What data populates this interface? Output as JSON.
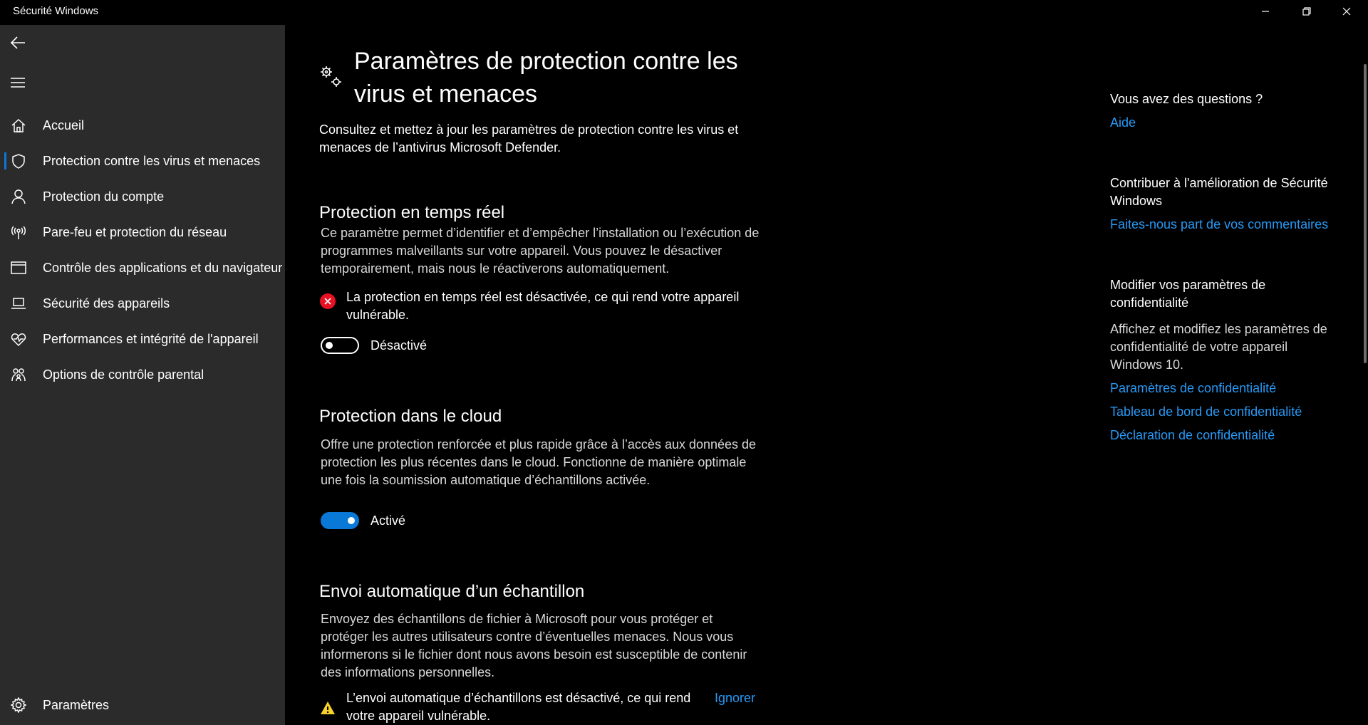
{
  "window": {
    "title": "Sécurité Windows"
  },
  "sidebar": {
    "items": [
      {
        "label": "Accueil",
        "icon": "home-icon"
      },
      {
        "label": "Protection contre les virus et menaces",
        "icon": "shield-icon",
        "selected": true
      },
      {
        "label": "Protection du compte",
        "icon": "person-icon"
      },
      {
        "label": "Pare-feu et protection du réseau",
        "icon": "wireless-icon"
      },
      {
        "label": "Contrôle des applications et du navigateur",
        "icon": "browser-window-icon"
      },
      {
        "label": "Sécurité des appareils",
        "icon": "laptop-icon"
      },
      {
        "label": "Performances et intégrité de l'appareil",
        "icon": "heart-pulse-icon"
      },
      {
        "label": "Options de contrôle parental",
        "icon": "family-icon"
      }
    ],
    "settings_label": "Paramètres"
  },
  "main": {
    "title": "Paramètres de protection contre les virus et menaces",
    "description": "Consultez et mettez à jour les paramètres de protection contre les virus et menaces de l’antivirus Microsoft Defender.",
    "realtime": {
      "heading": "Protection en temps réel",
      "description": "Ce paramètre permet d’identifier et d’empêcher l’installation ou l’exécution de programmes malveillants sur votre appareil. Vous pouvez le désactiver temporairement, mais nous le réactiverons automatiquement.",
      "status": "La protection en temps réel est désactivée, ce qui rend votre appareil vulnérable.",
      "toggle_label": "Désactivé",
      "toggle_on": false
    },
    "cloud": {
      "heading": "Protection dans le cloud",
      "description": "Offre une protection renforcée et plus rapide grâce à l’accès aux données de protection les plus récentes dans le cloud. Fonctionne de manière optimale une fois la soumission automatique d’échantillons activée.",
      "toggle_label": "Activé",
      "toggle_on": true
    },
    "sample": {
      "heading": "Envoi automatique d’un échantillon",
      "description": "Envoyez des échantillons de fichier à Microsoft pour vous protéger et protéger les autres utilisateurs contre d’éventuelles menaces. Nous vous informerons si le fichier dont nous avons besoin est susceptible de contenir des informations personnelles.",
      "status": "L’envoi automatique d’échantillons est désactivé, ce qui rend votre appareil vulnérable.",
      "ignore_link": "Ignorer"
    }
  },
  "right": {
    "questions": {
      "heading": "Vous avez des questions ?",
      "link": "Aide"
    },
    "contribute": {
      "heading": "Contribuer à l'amélioration de Sécurité Windows",
      "link": "Faites-nous part de vos commentaires"
    },
    "privacy": {
      "heading": "Modifier vos paramètres de confidentialité",
      "text": "Affichez et modifiez les paramètres de confidentialité de votre appareil Windows 10.",
      "links": [
        "Paramètres de confidentialité",
        "Tableau de bord de confidentialité",
        "Déclaration de confidentialité"
      ]
    }
  },
  "colors": {
    "accent": "#0a78d7",
    "link": "#2899f5",
    "error": "#e81123",
    "warning": "#f8d22a",
    "sidebar": "#2b2b2b"
  }
}
